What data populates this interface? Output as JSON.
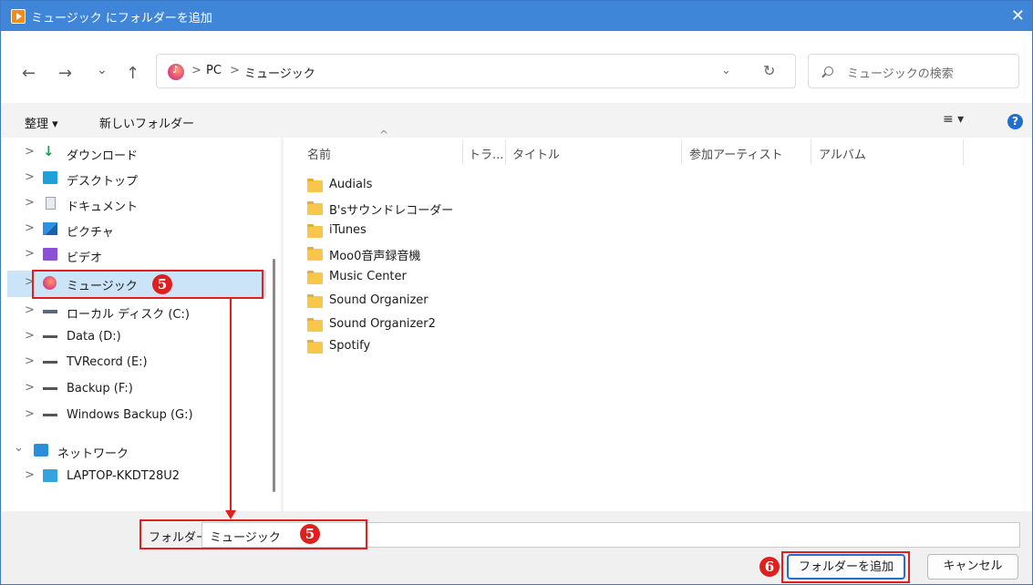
{
  "window": {
    "title": "ミュージック にフォルダーを追加",
    "close": "✕"
  },
  "nav": {
    "back": "←",
    "forward": "→",
    "recent": "⌄",
    "up": "↑",
    "breadcrumb": [
      ">",
      "PC",
      ">",
      "ミュージック"
    ],
    "dropdown": "⌄",
    "refresh": "↻",
    "search_placeholder": "ミュージックの検索"
  },
  "command_bar": {
    "organize": "整理 ▾",
    "new_folder": "新しいフォルダー",
    "view": "≡ ▾",
    "help": "?"
  },
  "sidebar": {
    "items": [
      {
        "label": "ダウンロード",
        "icon": "download-icon",
        "chevron": ">"
      },
      {
        "label": "デスクトップ",
        "icon": "desktop-icon",
        "chevron": ">"
      },
      {
        "label": "ドキュメント",
        "icon": "documents-icon",
        "chevron": ">"
      },
      {
        "label": "ピクチャ",
        "icon": "pictures-icon",
        "chevron": ">"
      },
      {
        "label": "ビデオ",
        "icon": "videos-icon",
        "chevron": ">"
      },
      {
        "label": "ミュージック",
        "icon": "music-icon",
        "chevron": ">"
      },
      {
        "label": "ローカル ディスク (C:)",
        "icon": "local-disk-icon",
        "chevron": ">"
      },
      {
        "label": "Data (D:)",
        "icon": "drive-icon",
        "chevron": ">"
      },
      {
        "label": "TVRecord (E:)",
        "icon": "drive-icon",
        "chevron": ">"
      },
      {
        "label": "Backup (F:)",
        "icon": "drive-icon",
        "chevron": ">"
      },
      {
        "label": "Windows Backup (G:)",
        "icon": "drive-icon",
        "chevron": ">"
      },
      {
        "label": "ネットワーク",
        "icon": "network-icon",
        "chevron": "⌄"
      },
      {
        "label": "LAPTOP-KKDT28U2",
        "icon": "computer-icon",
        "chevron": ">"
      }
    ]
  },
  "columns": {
    "name": "名前",
    "track": "トラ...",
    "title": "タイトル",
    "artist": "参加アーティスト",
    "album": "アルバム"
  },
  "files": [
    "Audials",
    "B'sサウンドレコーダー",
    "iTunes",
    "Moo0音声録音機",
    "Music Center",
    "Sound Organizer",
    "Sound Organizer2",
    "Spotify"
  ],
  "bottom": {
    "folder_label": "フォルダー:",
    "folder_value": "ミュージック",
    "add_button": "フォルダーを追加",
    "cancel_button": "キャンセル"
  },
  "annotations": {
    "step5": "5",
    "step6": "6"
  },
  "colors": {
    "accent": "#3f86d9",
    "annotation_red": "#e0201f",
    "selection": "#cce4f7"
  }
}
